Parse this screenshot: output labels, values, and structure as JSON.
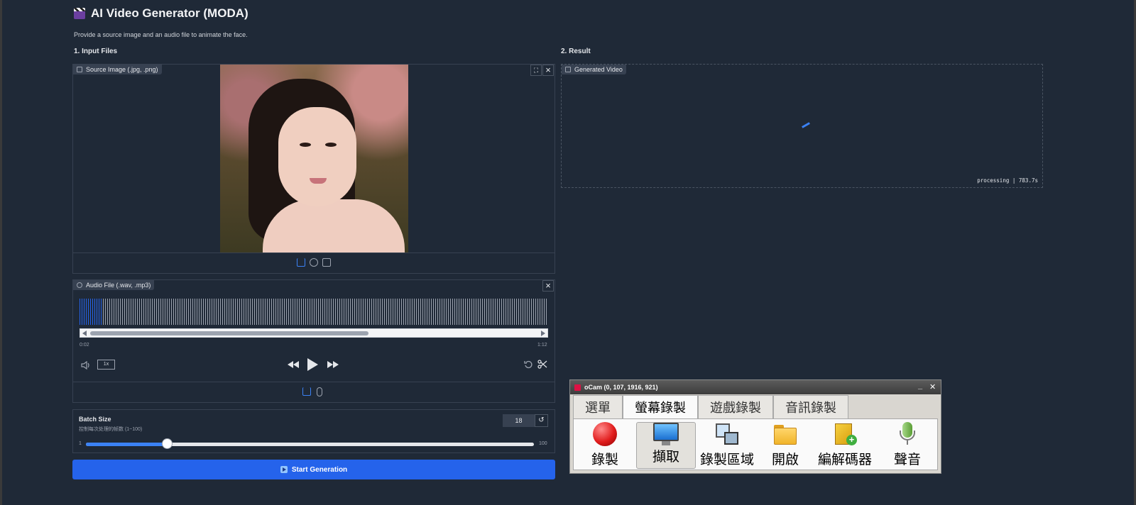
{
  "app": {
    "title": "AI Video Generator (MODA)",
    "description": "Provide a source image and an audio file to animate the face."
  },
  "input": {
    "section_title": "1. Input Files",
    "source_image": {
      "label": "Source Image (.jpg, .png)"
    },
    "audio": {
      "label": "Audio File (.wav, .mp3)",
      "current_time": "0:02",
      "duration": "1:12",
      "playback_rate": "1x",
      "played_fraction": 0.05
    },
    "batch": {
      "label": "Batch Size",
      "sublabel": "控制每次处理的帧数 (1~100)",
      "value": "18",
      "min": "1",
      "max": "100",
      "value_fraction": 0.18
    },
    "start_button": "Start Generation"
  },
  "result": {
    "section_title": "2. Result",
    "video_label": "Generated Video",
    "status": "processing | 783.7s"
  },
  "ocam": {
    "title": "oCam (0, 107, 1916, 921)",
    "minimize": "_",
    "close": "✕",
    "tabs": [
      "選單",
      "螢幕錄製",
      "遊戲錄製",
      "音訊錄製"
    ],
    "active_tab": 1,
    "buttons": [
      {
        "label": "錄製",
        "icon": "record-icon"
      },
      {
        "label": "擷取",
        "icon": "monitor-icon"
      },
      {
        "label": "錄製區域",
        "icon": "region-icon"
      },
      {
        "label": "開啟",
        "icon": "folder-icon"
      },
      {
        "label": "編解碼器",
        "icon": "codec-icon"
      },
      {
        "label": "聲音",
        "icon": "microphone-icon"
      }
    ],
    "colors": {
      "record": "#e11d1d",
      "folder": "#f0b429",
      "mic": "#7cbf4a"
    }
  },
  "colors": {
    "background": "#1f2937",
    "accent": "#2563eb",
    "panel_border": "#374151"
  }
}
